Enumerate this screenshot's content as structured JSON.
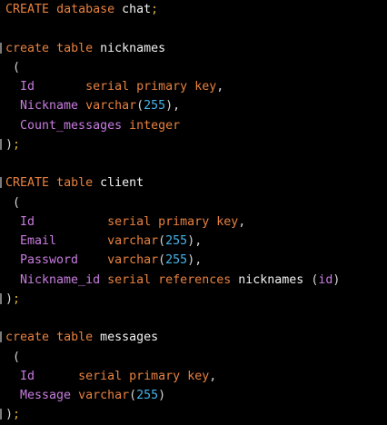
{
  "colors": {
    "background": "#000000",
    "keyword": "#e8813f",
    "identifier": "#f2f2f2",
    "field": "#c87ce0",
    "number": "#45b3ea",
    "punctuation": "#d7d7d7",
    "semicolon": "#d9b238"
  },
  "lines": [
    [
      [
        "kw",
        "CREATE"
      ],
      [
        "ws",
        " "
      ],
      [
        "kw",
        "database"
      ],
      [
        "ws",
        " "
      ],
      [
        "id",
        "chat"
      ],
      [
        "sem",
        ";"
      ]
    ],
    [],
    [
      [
        "kw",
        "create"
      ],
      [
        "ws",
        " "
      ],
      [
        "kw",
        "table"
      ],
      [
        "ws",
        " "
      ],
      [
        "id",
        "nicknames"
      ]
    ],
    [
      [
        "ws",
        " "
      ],
      [
        "pun",
        "("
      ]
    ],
    [
      [
        "ws",
        "  "
      ],
      [
        "fld",
        "Id"
      ],
      [
        "ws",
        "       "
      ],
      [
        "kw",
        "serial"
      ],
      [
        "ws",
        " "
      ],
      [
        "kw",
        "primary"
      ],
      [
        "ws",
        " "
      ],
      [
        "kw",
        "key"
      ],
      [
        "pun",
        ","
      ]
    ],
    [
      [
        "ws",
        "  "
      ],
      [
        "fld",
        "Nickname"
      ],
      [
        "ws",
        " "
      ],
      [
        "kw",
        "varchar"
      ],
      [
        "pun",
        "("
      ],
      [
        "num",
        "255"
      ],
      [
        "pun",
        "),"
      ]
    ],
    [
      [
        "ws",
        "  "
      ],
      [
        "fld",
        "Count_messages"
      ],
      [
        "ws",
        " "
      ],
      [
        "kw",
        "integer"
      ]
    ],
    [
      [
        "pun",
        ")"
      ],
      [
        "sem",
        ";"
      ]
    ],
    [],
    [
      [
        "kw",
        "CREATE"
      ],
      [
        "ws",
        " "
      ],
      [
        "kw",
        "table"
      ],
      [
        "ws",
        " "
      ],
      [
        "id",
        "client"
      ]
    ],
    [
      [
        "ws",
        " "
      ],
      [
        "pun",
        "("
      ]
    ],
    [
      [
        "ws",
        "  "
      ],
      [
        "fld",
        "Id"
      ],
      [
        "ws",
        "          "
      ],
      [
        "kw",
        "serial"
      ],
      [
        "ws",
        " "
      ],
      [
        "kw",
        "primary"
      ],
      [
        "ws",
        " "
      ],
      [
        "kw",
        "key"
      ],
      [
        "pun",
        ","
      ]
    ],
    [
      [
        "ws",
        "  "
      ],
      [
        "fld",
        "Email"
      ],
      [
        "ws",
        "       "
      ],
      [
        "kw",
        "varchar"
      ],
      [
        "pun",
        "("
      ],
      [
        "num",
        "255"
      ],
      [
        "pun",
        "),"
      ]
    ],
    [
      [
        "ws",
        "  "
      ],
      [
        "fld",
        "Password"
      ],
      [
        "ws",
        "    "
      ],
      [
        "kw",
        "varchar"
      ],
      [
        "pun",
        "("
      ],
      [
        "num",
        "255"
      ],
      [
        "pun",
        "),"
      ]
    ],
    [
      [
        "ws",
        "  "
      ],
      [
        "fld",
        "Nickname_id"
      ],
      [
        "ws",
        " "
      ],
      [
        "kw",
        "serial"
      ],
      [
        "ws",
        " "
      ],
      [
        "kw",
        "references"
      ],
      [
        "ws",
        " "
      ],
      [
        "id",
        "nicknames"
      ],
      [
        "ws",
        " "
      ],
      [
        "pun",
        "("
      ],
      [
        "fld",
        "id"
      ],
      [
        "pun",
        ")"
      ]
    ],
    [
      [
        "pun",
        ")"
      ],
      [
        "sem",
        ";"
      ]
    ],
    [],
    [
      [
        "kw",
        "create"
      ],
      [
        "ws",
        " "
      ],
      [
        "kw",
        "table"
      ],
      [
        "ws",
        " "
      ],
      [
        "id",
        "messages"
      ]
    ],
    [
      [
        "ws",
        " "
      ],
      [
        "pun",
        "("
      ]
    ],
    [
      [
        "ws",
        "  "
      ],
      [
        "fld",
        "Id"
      ],
      [
        "ws",
        "      "
      ],
      [
        "kw",
        "serial"
      ],
      [
        "ws",
        " "
      ],
      [
        "kw",
        "primary"
      ],
      [
        "ws",
        " "
      ],
      [
        "kw",
        "key"
      ],
      [
        "pun",
        ","
      ]
    ],
    [
      [
        "ws",
        "  "
      ],
      [
        "fld",
        "Message"
      ],
      [
        "ws",
        " "
      ],
      [
        "kw",
        "varchar"
      ],
      [
        "pun",
        "("
      ],
      [
        "num",
        "255"
      ],
      [
        "pun",
        ")"
      ]
    ],
    [
      [
        "pun",
        ")"
      ],
      [
        "sem",
        ";"
      ]
    ]
  ]
}
